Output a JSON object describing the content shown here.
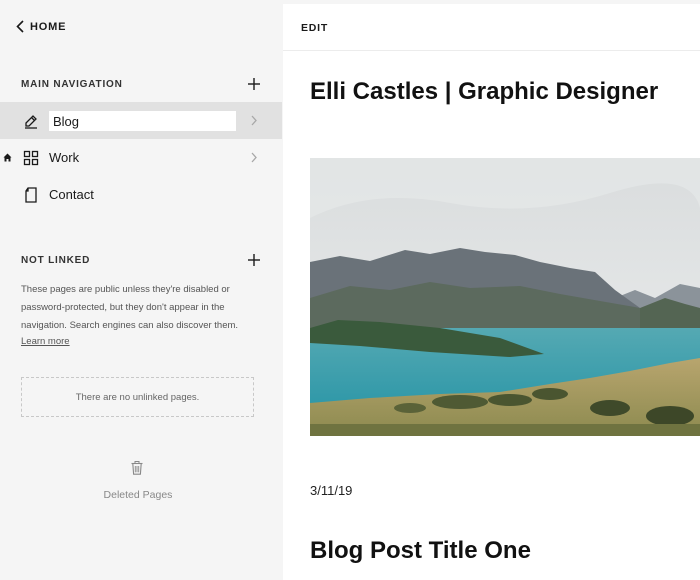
{
  "sidebar": {
    "home_label": "HOME",
    "main_nav": {
      "title": "MAIN NAVIGATION",
      "items": [
        {
          "label": "Blog",
          "icon": "blog-edit-icon",
          "active": true,
          "editing": true
        },
        {
          "label": "Work",
          "icon": "grid-icon",
          "homepage": true
        },
        {
          "label": "Contact",
          "icon": "page-icon"
        }
      ]
    },
    "not_linked": {
      "title": "NOT LINKED",
      "description": "These pages are public unless they're disabled or password-protected, but they don't appear in the navigation. Search engines can also discover them.",
      "learn_more": "Learn more",
      "empty_message": "There are no unlinked pages."
    },
    "deleted_label": "Deleted Pages"
  },
  "main": {
    "edit_label": "EDIT",
    "site_title": "Elli Castles | Graphic Designer",
    "post_date": "3/11/19",
    "post_title": "Blog Post Title One"
  }
}
